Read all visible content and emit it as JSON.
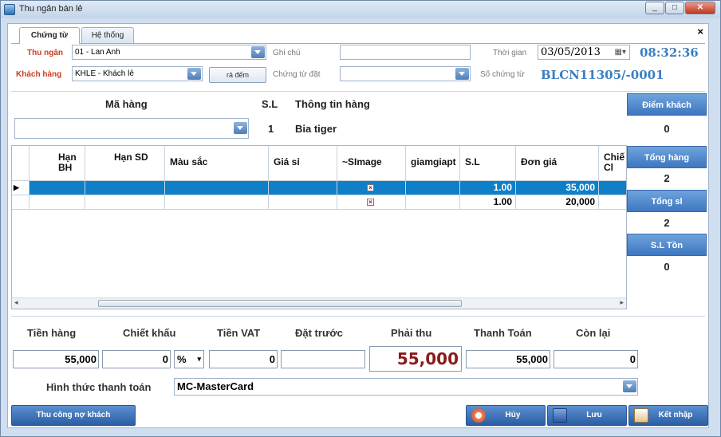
{
  "window": {
    "title": "Thu ngân bán lẻ"
  },
  "tabs": [
    {
      "label": "Chứng từ"
    },
    {
      "label": "Hệ thống"
    }
  ],
  "form": {
    "cashier_label": "Thu ngân",
    "cashier_value": "01 - Lan Anh",
    "note_label": "Ghi chú",
    "note_value": "",
    "time_label": "Thời gian",
    "date_value": "03/05/2013",
    "clock": "08:32:36",
    "customer_label": "Khách hàng",
    "customer_value": "KHLE - Khách lẻ",
    "return_button": "rả đếm",
    "deposit_doc_label": "Chứng từ đặt",
    "deposit_doc_value": "",
    "doc_no_label": "Số chứng từ",
    "doc_no_value": "BLCN11305/-0001"
  },
  "product": {
    "code_header": "Mã hàng",
    "qty_header": "S.L",
    "info_header": "Thông tin hàng",
    "code_value": "",
    "qty_value": "1",
    "info_value": "Bia tiger"
  },
  "grid": {
    "columns": [
      "Hạn BH",
      "Hạn SD",
      "Màu sắc",
      "Giá sỉ",
      "~SImage",
      "giamgiapt",
      "S.L",
      "Đơn giá",
      "Chiế Cl"
    ],
    "rows": [
      {
        "qty": "1.00",
        "price": "35,000",
        "selected": true
      },
      {
        "qty": "1.00",
        "price": "20,000",
        "selected": false
      }
    ]
  },
  "side": {
    "customer_points_label": "Điểm khách",
    "customer_points_value": "0",
    "total_items_label": "Tổng hàng",
    "total_items_value": "2",
    "total_qty_label": "Tổng sl",
    "total_qty_value": "2",
    "stock_label": "S.L Tồn",
    "stock_value": "0"
  },
  "summary": {
    "goods_label": "Tiền hàng",
    "goods_value": "55,000",
    "discount_label": "Chiết khấu",
    "discount_value": "0",
    "discount_unit": "%",
    "vat_label": "Tiền VAT",
    "vat_value": "0",
    "prepaid_label": "Đặt trước",
    "prepaid_value": "",
    "payable_label": "Phải thu",
    "payable_value": "55,000",
    "paid_label": "Thanh Toán",
    "paid_value": "55,000",
    "remaining_label": "Còn lại",
    "remaining_value": "0",
    "payment_method_label": "Hình thức thanh toán",
    "payment_method_value": "MC-MasterCard"
  },
  "buttons": {
    "collect_debt": "Thu công nợ khách",
    "cancel": "Hủy",
    "save": "Lưu",
    "finish": "Kết nhập"
  }
}
